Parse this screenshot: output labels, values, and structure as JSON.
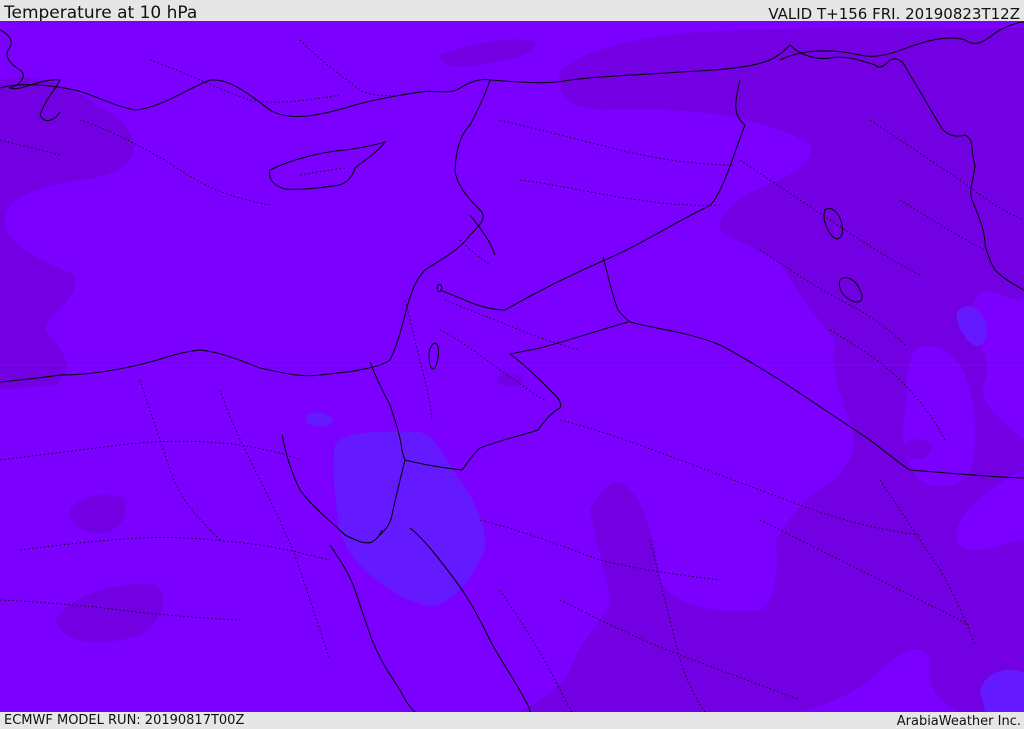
{
  "header": {
    "title": "Temperature at 10 hPa",
    "valid": "VALID T+156 FRI. 20190823T12Z"
  },
  "footer": {
    "model_run": "ECMWF MODEL RUN: 20190817T00Z",
    "credit": "ArabiaWeather Inc."
  },
  "map": {
    "colors": {
      "base_field": "#7b00ff",
      "warm_field": "#7300e2",
      "cool_field": "#6419ff",
      "coastline": "#000000",
      "borders": "#000000"
    },
    "layers": [
      "temperature-field",
      "coastlines",
      "country-borders",
      "province-borders"
    ]
  }
}
